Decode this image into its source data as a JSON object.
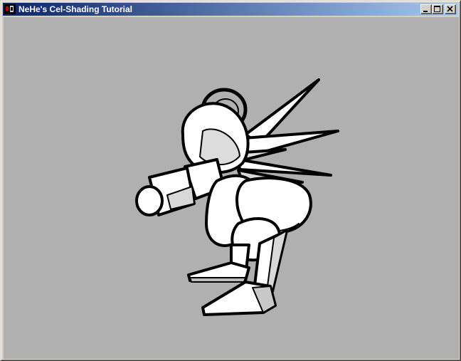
{
  "window": {
    "title": "NeHe's Cel-Shading Tutorial",
    "icon": "nehe-app-icon"
  },
  "titlebar_controls": {
    "minimize": "minimize-icon",
    "maximize": "maximize-icon",
    "close": "close-icon"
  },
  "scene": {
    "background_color": "#b0b0b0",
    "model_fill": "#ffffff",
    "model_shade": "#d8d8d8",
    "outline_color": "#000000"
  }
}
